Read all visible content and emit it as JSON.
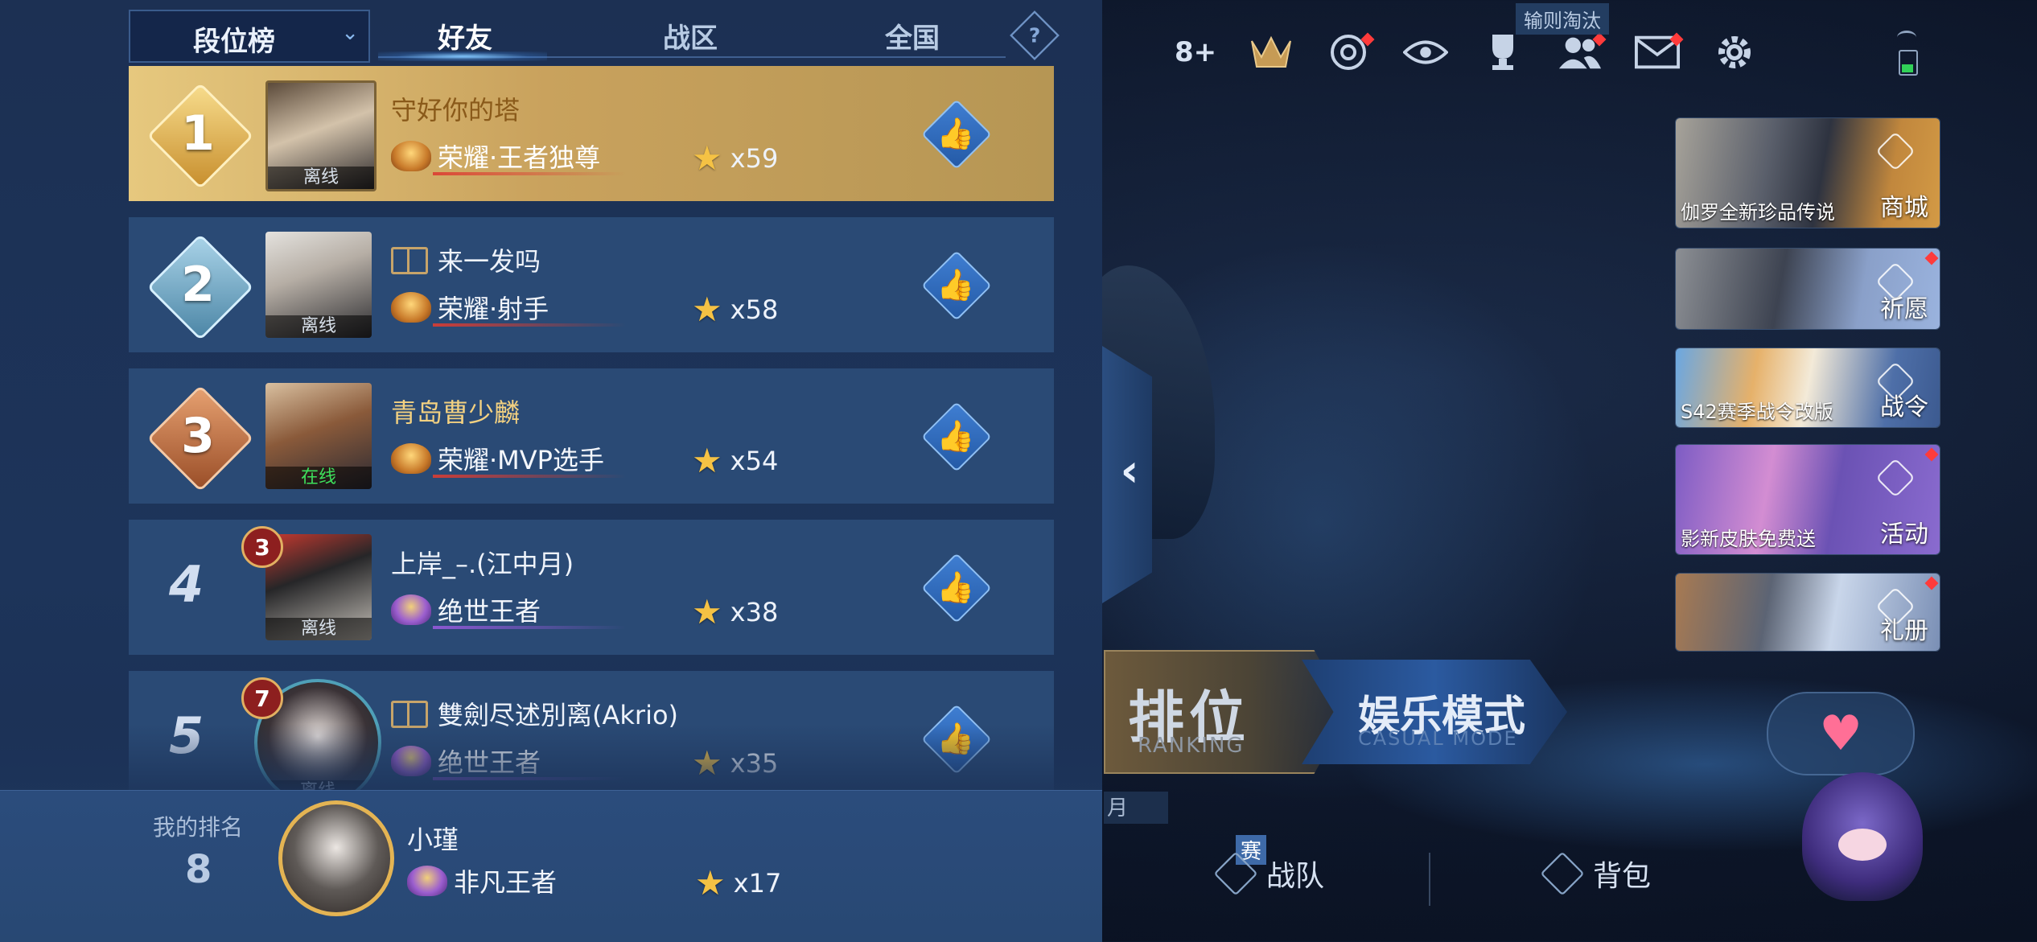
{
  "header": {
    "dropdown_label": "段位榜",
    "tabs": [
      {
        "label": "好友",
        "active": true
      },
      {
        "label": "战区",
        "active": false
      },
      {
        "label": "全国",
        "active": false
      }
    ],
    "help_glyph": "?"
  },
  "leaderboard": [
    {
      "rank": "1",
      "name": "守好你的塔",
      "status": "离线",
      "tier": "荣耀·王者独尊",
      "stars": "x59"
    },
    {
      "rank": "2",
      "name": "来一发吗",
      "status": "离线",
      "tier": "荣耀·射手",
      "stars": "x58"
    },
    {
      "rank": "3",
      "name": "青岛曹少麟",
      "status": "在线",
      "tier": "荣耀·MVP选手",
      "stars": "x54"
    },
    {
      "rank": "4",
      "name": "上岸_–.(江中月)",
      "status": "离线",
      "tier": "绝世王者",
      "stars": "x38",
      "level": "3"
    },
    {
      "rank": "5",
      "name": "雙劍尽述別离(Akrio)",
      "status": "离线",
      "tier": "绝世王者",
      "stars": "x35",
      "level": "7"
    }
  ],
  "my_rank": {
    "label": "我的排名",
    "rank": "8",
    "name": "小瑾",
    "tier": "非凡王者",
    "stars": "x17"
  },
  "top_bar": {
    "count_label": "8+",
    "tooltip": "输则淘汰",
    "icons": [
      "tier-crown-icon",
      "target-icon",
      "eye-icon",
      "trophy-icon",
      "friends-icon",
      "mail-icon",
      "gear-icon"
    ]
  },
  "side_panels": [
    {
      "caption": "伽罗全新珍品传说",
      "label": "商城"
    },
    {
      "caption": "",
      "label": "祈愿"
    },
    {
      "caption": "S42赛季战令改版",
      "label": "战令"
    },
    {
      "caption": "影新皮肤免费送",
      "label": "活动"
    },
    {
      "caption": "",
      "label": "礼册"
    }
  ],
  "modes": {
    "ranked_label": "排位",
    "ranked_sub": "RANKING",
    "casual_label": "娱乐模式",
    "casual_sub": "CASUAL MODE"
  },
  "bottom_nav": {
    "team_badge": "赛",
    "team_label": "战队",
    "bag_label": "背包",
    "stub_tag": "月"
  },
  "colors": {
    "gold_row": "#e6c87e",
    "row_blue": "#2a4a75",
    "online_green": "#3ee05c",
    "star_gold": "#f5c244"
  }
}
